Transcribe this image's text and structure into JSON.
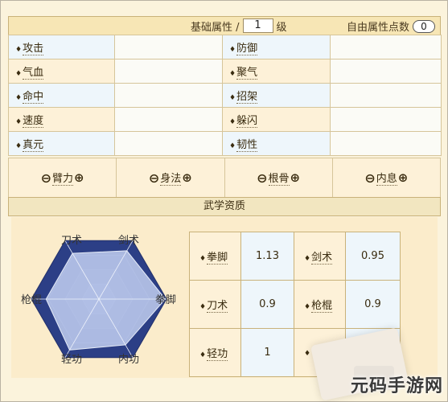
{
  "header": {
    "title": "基础属性 /",
    "level": "1",
    "level_unit": "级",
    "free_points_label": "自由属性点数",
    "free_points": "0"
  },
  "attributes": {
    "rows": [
      {
        "left": "攻击",
        "right": "防御"
      },
      {
        "left": "气血",
        "right": "聚气"
      },
      {
        "left": "命中",
        "right": "招架"
      },
      {
        "left": "速度",
        "right": "躲闪"
      },
      {
        "left": "真元",
        "right": "韧性"
      }
    ]
  },
  "points": [
    {
      "name": "臂力"
    },
    {
      "name": "身法"
    },
    {
      "name": "根骨"
    },
    {
      "name": "内息"
    }
  ],
  "martial": {
    "title": "武学资质",
    "radar_labels": [
      "刀术",
      "剑术",
      "拳脚",
      "内功",
      "轻功",
      "枪棍"
    ],
    "aptitudes": [
      {
        "left_name": "拳脚",
        "left_value": "1.13",
        "right_name": "剑术",
        "right_value": "0.95"
      },
      {
        "left_name": "刀术",
        "left_value": "0.9",
        "right_name": "枪棍",
        "right_value": "0.9"
      },
      {
        "left_name": "轻功",
        "left_value": "1",
        "right_name": "",
        "right_value": ""
      }
    ],
    "radar_values": {
      "刀术": 0.9,
      "剑术": 0.95,
      "拳脚": 1.13,
      "内功": 0.9,
      "轻功": 1.0,
      "枪棍": 0.9
    }
  },
  "watermark": "元码手游网",
  "icons": {
    "diamond": "♦",
    "minus": "⊖",
    "plus": "⊕"
  },
  "colors": {
    "accent": "#f7e6b5",
    "radar_fill": "#2c3f86",
    "header_border": "#c9b27a"
  }
}
